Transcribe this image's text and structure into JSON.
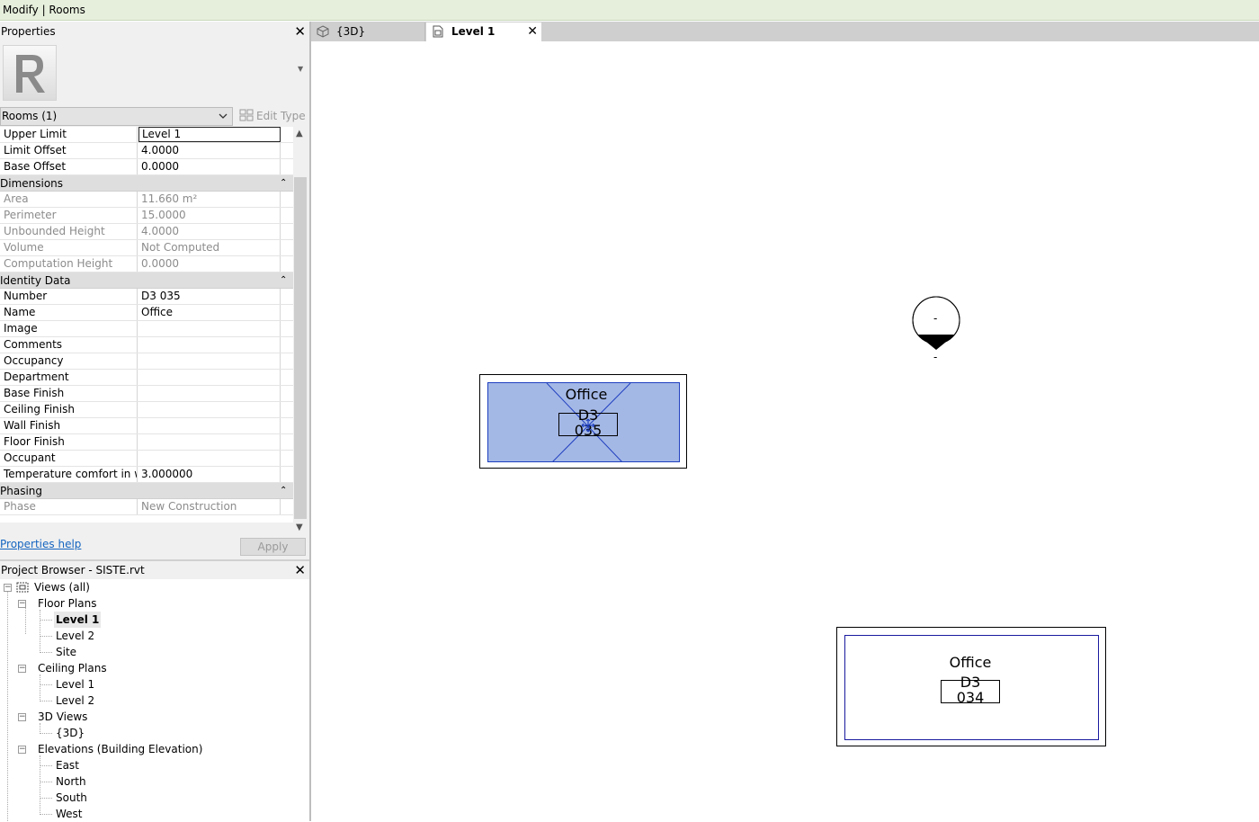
{
  "context_bar": {
    "title": "Modify | Rooms"
  },
  "properties": {
    "title": "Properties",
    "close_glyph": "✕",
    "type_icon": "revit-logo-icon",
    "type_selector": "Rooms (1)",
    "edit_type": "Edit Type",
    "rows": [
      {
        "label": "Upper Limit",
        "value": "Level 1",
        "state": "editing"
      },
      {
        "label": "Limit Offset",
        "value": "4.0000",
        "state": "normal"
      },
      {
        "label": "Base Offset",
        "value": "0.0000",
        "state": "normal"
      }
    ],
    "groups": {
      "dimensions": {
        "label": "Dimensions",
        "rows": [
          {
            "label": "Area",
            "value": "11.660 m²"
          },
          {
            "label": "Perimeter",
            "value": "15.0000"
          },
          {
            "label": "Unbounded Height",
            "value": "4.0000"
          },
          {
            "label": "Volume",
            "value": "Not Computed"
          },
          {
            "label": "Computation Height",
            "value": "0.0000"
          }
        ]
      },
      "identity": {
        "label": "Identity Data",
        "rows": [
          {
            "label": "Number",
            "value": "D3 035"
          },
          {
            "label": "Name",
            "value": "Office"
          },
          {
            "label": "Image",
            "value": ""
          },
          {
            "label": "Comments",
            "value": ""
          },
          {
            "label": "Occupancy",
            "value": ""
          },
          {
            "label": "Department",
            "value": ""
          },
          {
            "label": "Base Finish",
            "value": ""
          },
          {
            "label": "Ceiling Finish",
            "value": ""
          },
          {
            "label": "Wall Finish",
            "value": ""
          },
          {
            "label": "Floor Finish",
            "value": ""
          },
          {
            "label": "Occupant",
            "value": ""
          },
          {
            "label": "Temperature comfort in w...",
            "value": "3.000000"
          }
        ]
      },
      "phasing": {
        "label": "Phasing",
        "rows": [
          {
            "label": "Phase",
            "value": "New Construction"
          }
        ]
      }
    },
    "help_link": "Properties help",
    "apply": "Apply"
  },
  "browser": {
    "title": "Project Browser - SISTE.rvt",
    "views_all": "Views (all)",
    "floor_plans": {
      "label": "Floor Plans",
      "items": [
        "Level 1",
        "Level 2",
        "Site"
      ]
    },
    "ceiling_plans": {
      "label": "Ceiling Plans",
      "items": [
        "Level 1",
        "Level 2"
      ]
    },
    "views_3d": {
      "label": "3D Views",
      "items": [
        "{3D}"
      ]
    },
    "elevations": {
      "label": "Elevations (Building Elevation)",
      "items": [
        "East",
        "North",
        "South",
        "West"
      ]
    }
  },
  "tabs": [
    {
      "label": "{3D}",
      "icon": "3d-view-icon",
      "active": false
    },
    {
      "label": "Level 1",
      "icon": "floor-plan-icon",
      "active": true
    }
  ],
  "canvas": {
    "selected_room": {
      "name": "Office",
      "number_line1": "D3",
      "number_line2": "035"
    },
    "other_room": {
      "name": "Office",
      "number_line1": "D3",
      "number_line2": "034"
    },
    "elevation_marker": {
      "top_text": "-",
      "bottom_text": "-"
    },
    "colors": {
      "selection_fill": "#a4b8e6",
      "selection_stroke": "#1f3fbf",
      "room_boundary": "#1a1aa0"
    }
  }
}
